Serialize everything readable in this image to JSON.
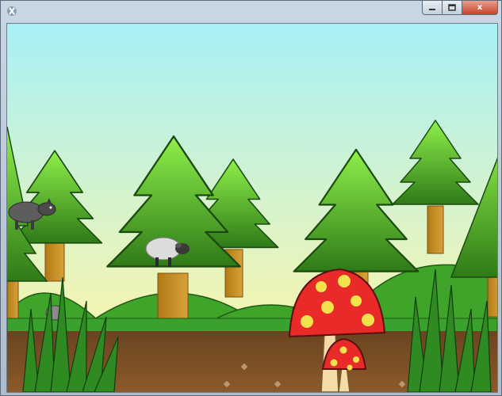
{
  "window": {
    "title": "",
    "app_icon": "app-icon",
    "controls": {
      "minimize_icon": "minimize-icon",
      "maximize_icon": "maximize-icon",
      "close_label": "x"
    }
  },
  "scene": {
    "sky_colors": [
      "#a8f0f6",
      "#f5f5b0"
    ],
    "tree_colors": [
      "#8ff04a",
      "#2f7a18"
    ],
    "hill_color": "#3fa52a",
    "ground_color": "#7a4f22",
    "grass_strip_color": "#3ba12e",
    "mushroom_cap_color": "#e82a28",
    "mushroom_spot_color": "#f2e24c",
    "characters": [
      {
        "name": "wolf",
        "icon": "wolf-icon",
        "color": "#5d5d5d"
      },
      {
        "name": "sheep",
        "icon": "sheep-icon",
        "color": "#dcdcdc"
      }
    ]
  }
}
